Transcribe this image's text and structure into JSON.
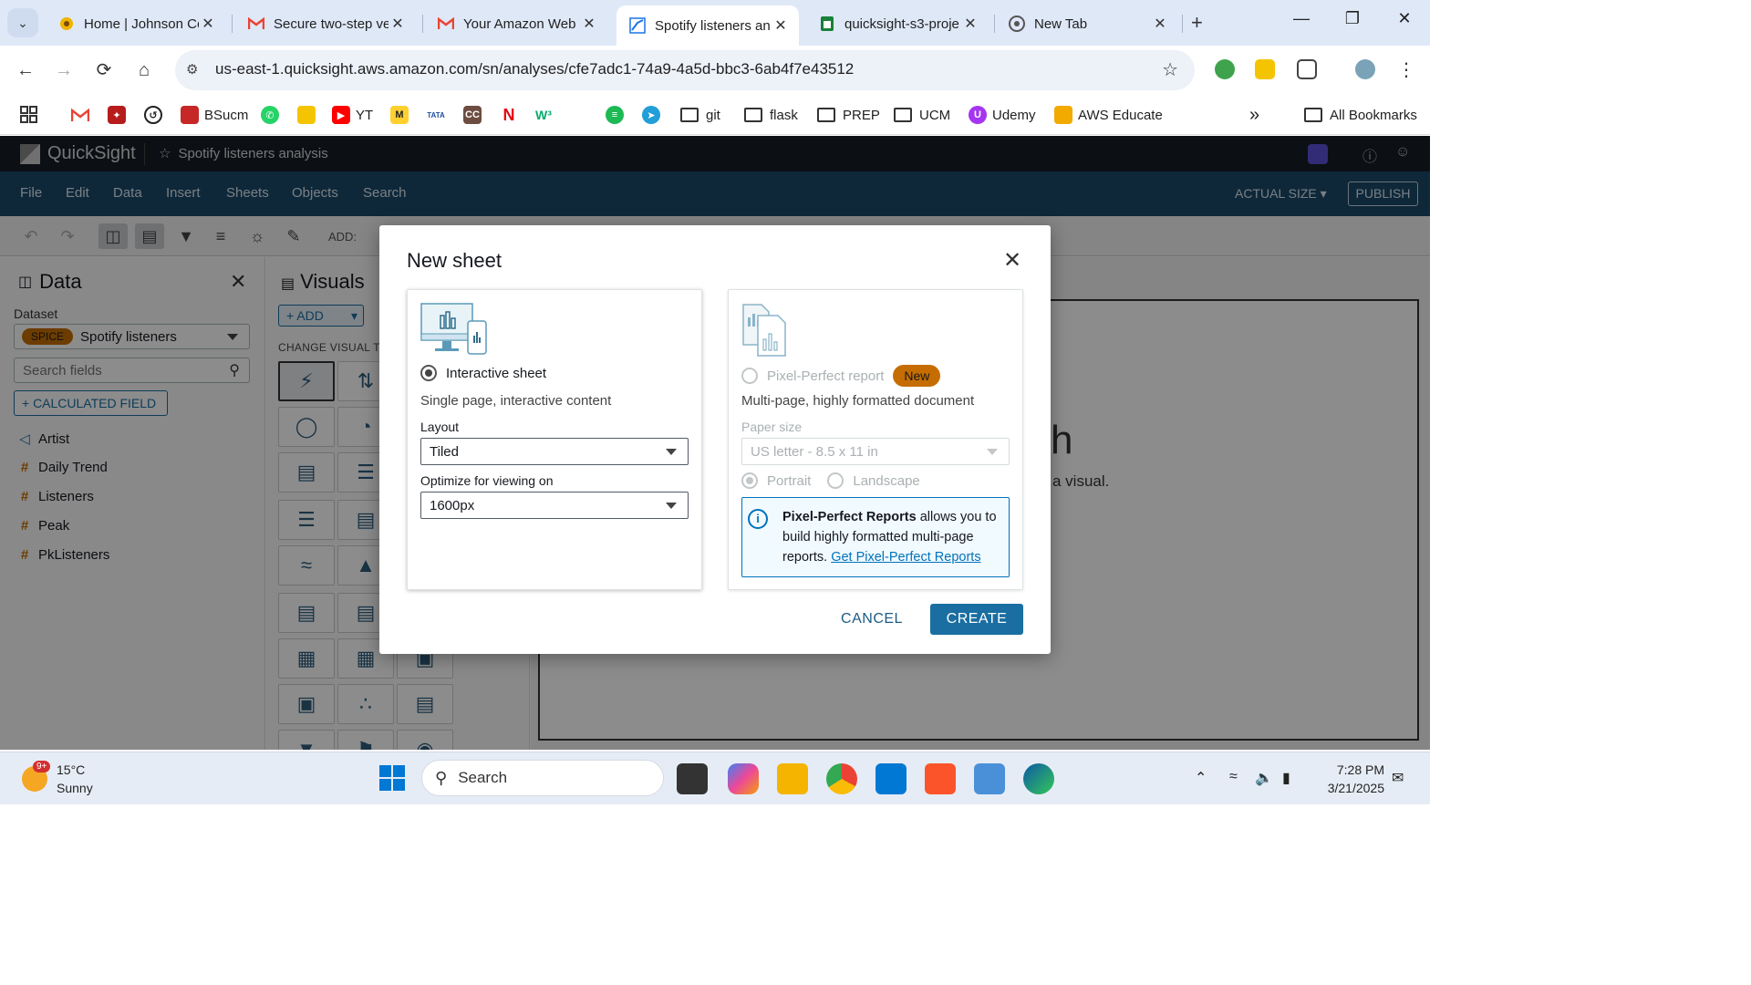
{
  "browser": {
    "tabs": [
      {
        "title": "Home | Johnson Co",
        "active": false
      },
      {
        "title": "Secure two-step ve",
        "active": false
      },
      {
        "title": "Your Amazon Web",
        "active": false
      },
      {
        "title": "Spotify listeners an",
        "active": true
      },
      {
        "title": "quicksight-s3-proje",
        "active": false
      },
      {
        "title": "New Tab",
        "active": false
      }
    ],
    "url": "us-east-1.quicksight.aws.amazon.com/sn/analyses/cfe7adc1-74a9-4a5d-bbc3-6ab4f7e43512",
    "bookmarks": [
      "BSucm",
      "YT",
      "git",
      "flask",
      "PREP",
      "UCM",
      "Udemy",
      "AWS Educate",
      "All Bookmarks"
    ],
    "bookmark_short": {
      "tata": "TATA",
      "w3": "W³"
    }
  },
  "app": {
    "brand": "QuickSight",
    "analysis_name": "Spotify listeners analysis",
    "menus": [
      "File",
      "Edit",
      "Data",
      "Insert",
      "Sheets",
      "Objects",
      "Search"
    ],
    "actual_size": "ACTUAL SIZE",
    "publish": "PUBLISH",
    "add_label": "ADD:"
  },
  "data_panel": {
    "title": "Data",
    "dataset_label": "Dataset",
    "spice_badge": "SPICE",
    "dataset_name": "Spotify listeners",
    "search_placeholder": "Search fields",
    "calculated_field": "+  CALCULATED FIELD",
    "fields": [
      {
        "name": "Artist",
        "kind": "dimension"
      },
      {
        "name": "Daily Trend",
        "kind": "measure"
      },
      {
        "name": "Listeners",
        "kind": "measure"
      },
      {
        "name": "Peak",
        "kind": "measure"
      },
      {
        "name": "PkListeners",
        "kind": "measure"
      }
    ]
  },
  "visuals_panel": {
    "title": "Visuals",
    "add_button": "+ ADD",
    "change_visual_type": "CHANGE VISUAL TY"
  },
  "canvas": {
    "partial_heading": "h",
    "partial_text": "a visual."
  },
  "modal": {
    "title": "New sheet",
    "interactive": {
      "label": "Interactive sheet",
      "description": "Single page, interactive content",
      "layout_label": "Layout",
      "layout_value": "Tiled",
      "optimize_label": "Optimize for viewing on",
      "optimize_value": "1600px",
      "selected": true
    },
    "pixel_perfect": {
      "label": "Pixel-Perfect report",
      "badge": "New",
      "description": "Multi-page, highly formatted document",
      "paper_label": "Paper size",
      "paper_value": "US letter - 8.5 x 11 in",
      "portrait": "Portrait",
      "landscape": "Landscape",
      "info_bold": "Pixel-Perfect Reports",
      "info_text": " allows you to build highly formatted multi-page reports. ",
      "info_link": "Get Pixel-Perfect Reports"
    },
    "cancel": "CANCEL",
    "create": "CREATE"
  },
  "taskbar": {
    "temperature": "15°C",
    "condition": "Sunny",
    "notification_badge": "9+",
    "search_placeholder": "Search",
    "time": "7:28 PM",
    "date": "3/21/2025"
  },
  "colors": {
    "accent": "#1a6ea1",
    "qs_header": "#161d26",
    "qs_menubar": "#1a4a6b",
    "spice_badge": "#c56d00",
    "info_border": "#0073bb"
  }
}
